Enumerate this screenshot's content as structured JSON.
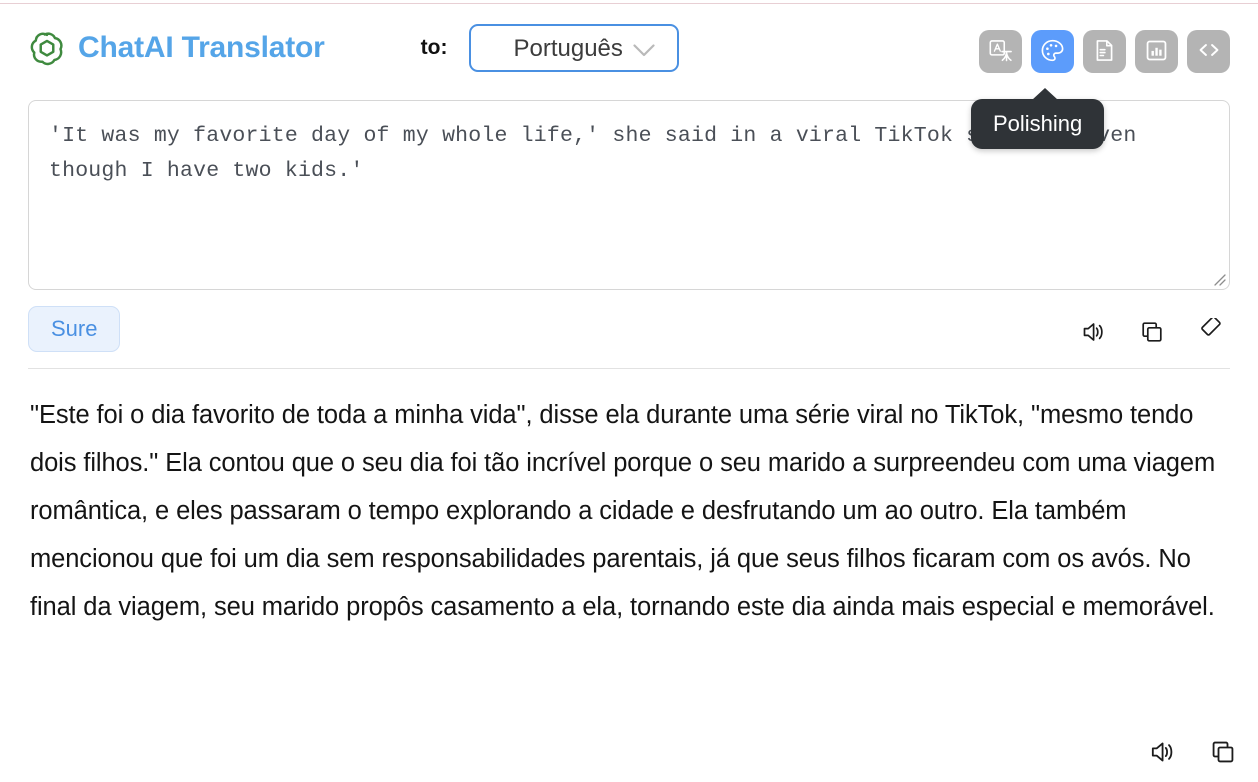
{
  "app": {
    "brand_title": "ChatAI Translator",
    "logo_icon": "openai-logo-icon"
  },
  "header": {
    "to_label": "to:",
    "language_select": {
      "value": "Português",
      "chevron_icon": "chevron-down-icon"
    },
    "toolbar": [
      {
        "name": "translate",
        "icon": "translate-icon",
        "active": false
      },
      {
        "name": "polishing",
        "icon": "palette-icon",
        "active": true
      },
      {
        "name": "summarize",
        "icon": "document-icon",
        "active": false
      },
      {
        "name": "analyze",
        "icon": "chart-icon",
        "active": false
      },
      {
        "name": "code",
        "icon": "code-icon",
        "active": false
      }
    ]
  },
  "tooltip": {
    "label": "Polishing"
  },
  "source": {
    "text": "'It was my favorite day of my whole life,' she said in a viral TikTok series, 'even though I have two kids.'",
    "resize_grip_icon": "resize-grip-icon"
  },
  "actions": {
    "primary_button": "Sure",
    "icons": [
      {
        "name": "speak",
        "icon": "speaker-icon"
      },
      {
        "name": "copy",
        "icon": "copy-icon"
      },
      {
        "name": "erase",
        "icon": "eraser-icon"
      }
    ]
  },
  "result": {
    "text": "\"Este foi o dia favorito de toda a minha vida\", disse ela durante uma série viral no TikTok, \"mesmo tendo dois filhos.\" Ela contou que o seu dia foi tão incrível porque o seu marido a surpreendeu com uma viagem romântica, e eles passaram o tempo explorando a cidade e desfrutando um ao outro. Ela também mencionou que foi um dia sem responsabilidades parentais, já que seus filhos ficaram com os avós. No final da viagem, seu marido propôs casamento a ela, tornando este dia ainda mais especial e memorável.",
    "icons": [
      {
        "name": "speak",
        "icon": "speaker-icon"
      },
      {
        "name": "copy",
        "icon": "copy-icon"
      }
    ]
  },
  "colors": {
    "brand": "#55a5e8",
    "accent": "#4a90e2",
    "active_tool": "#5c9cfb",
    "tool_inactive": "#b4b4b4",
    "tooltip_bg": "#2f3337",
    "logo_green": "#3f8a3f"
  }
}
